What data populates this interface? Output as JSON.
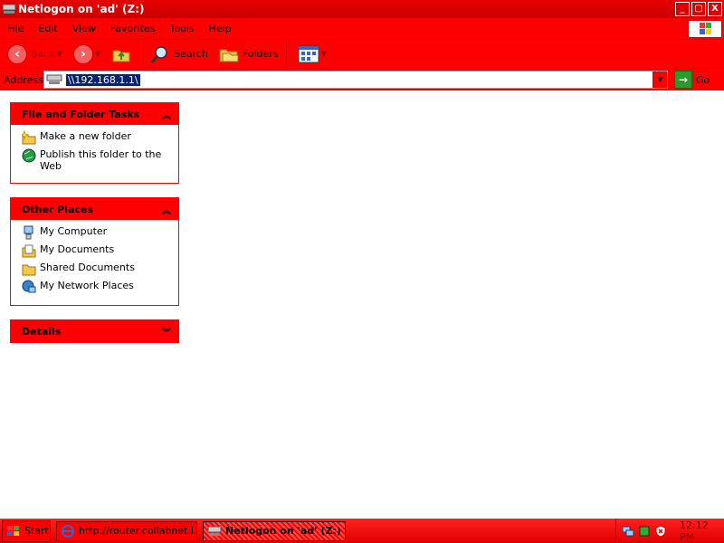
{
  "window": {
    "title": "Netlogon on 'ad' (Z:)",
    "controls": [
      "_",
      "▢",
      "X"
    ]
  },
  "menubar": {
    "items": [
      "File",
      "Edit",
      "View",
      "Favorites",
      "Tools",
      "Help"
    ]
  },
  "toolbar": {
    "back_label": "Back",
    "search_label": "Search",
    "folders_label": "Folders"
  },
  "addressbar": {
    "label": "Address",
    "value": "\\\\192.168.1.1\\",
    "go_label": "Go"
  },
  "panels": {
    "file_tasks": {
      "title": "File and Folder Tasks",
      "items": [
        "Make a new folder",
        "Publish this folder to the Web"
      ]
    },
    "other_places": {
      "title": "Other Places",
      "items": [
        "My Computer",
        "My Documents",
        "Shared Documents",
        "My Network Places"
      ]
    },
    "details": {
      "title": "Details"
    }
  },
  "taskbar": {
    "start_label": "Start",
    "tasks": [
      "http://router.collabnet.l...",
      "Netlogon on 'ad' (Z:)"
    ],
    "clock": "12:12 PM"
  },
  "colors": {
    "theme": "#ff0000",
    "titlebar": "#e00000",
    "address_highlight": "#0a246a"
  }
}
